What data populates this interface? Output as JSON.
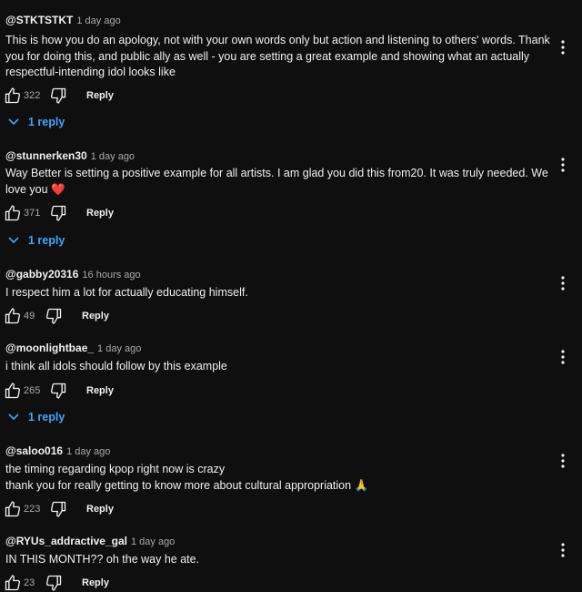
{
  "comments": [
    {
      "author": "@STKTSTKT",
      "time": "1 day ago",
      "text": "This is how you do an apology, not with your own words only but action and listening to others' words. Thank you for doing this, and public ally as well - you are setting a great example and showing what an actually respectful-intending idol looks like",
      "likes": "322",
      "reply_label": "Reply",
      "replies": "1 reply"
    },
    {
      "author": "@stunnerken30",
      "time": "1 day ago",
      "text": "Way Better is setting a positive example for all artists. I am glad you did this from20. It was truly needed. We love you ❤️",
      "likes": "371",
      "reply_label": "Reply",
      "replies": "1 reply"
    },
    {
      "author": "@gabby20316",
      "time": "16 hours ago",
      "text": "I respect him a lot for actually educating himself.",
      "likes": "49",
      "reply_label": "Reply"
    },
    {
      "author": "@moonlightbae_",
      "time": "1 day ago",
      "text": "i think all idols should follow by this example",
      "likes": "265",
      "reply_label": "Reply",
      "replies": "1 reply"
    },
    {
      "author": "@saloo016",
      "time": "1 day ago",
      "text_lines": [
        "the timing regarding kpop right now is crazy",
        "thank you for really getting to know more about cultural appropriation 🙏"
      ],
      "likes": "223",
      "reply_label": "Reply"
    },
    {
      "author": "@RYUs_addractive_gal",
      "time": "1 day ago",
      "text": "IN THIS MONTH?? oh the way he ate.",
      "likes": "23",
      "reply_label": "Reply"
    }
  ],
  "icons": {
    "like": "thumbs-up-icon",
    "dislike": "thumbs-down-icon",
    "more": "more-vertical-icon",
    "expand": "chevron-down-icon"
  },
  "colors": {
    "background": "#0f0f0f",
    "text": "#f1f1f1",
    "secondary_text": "#aaaaaa",
    "replies_link": "#3ea6ff"
  }
}
